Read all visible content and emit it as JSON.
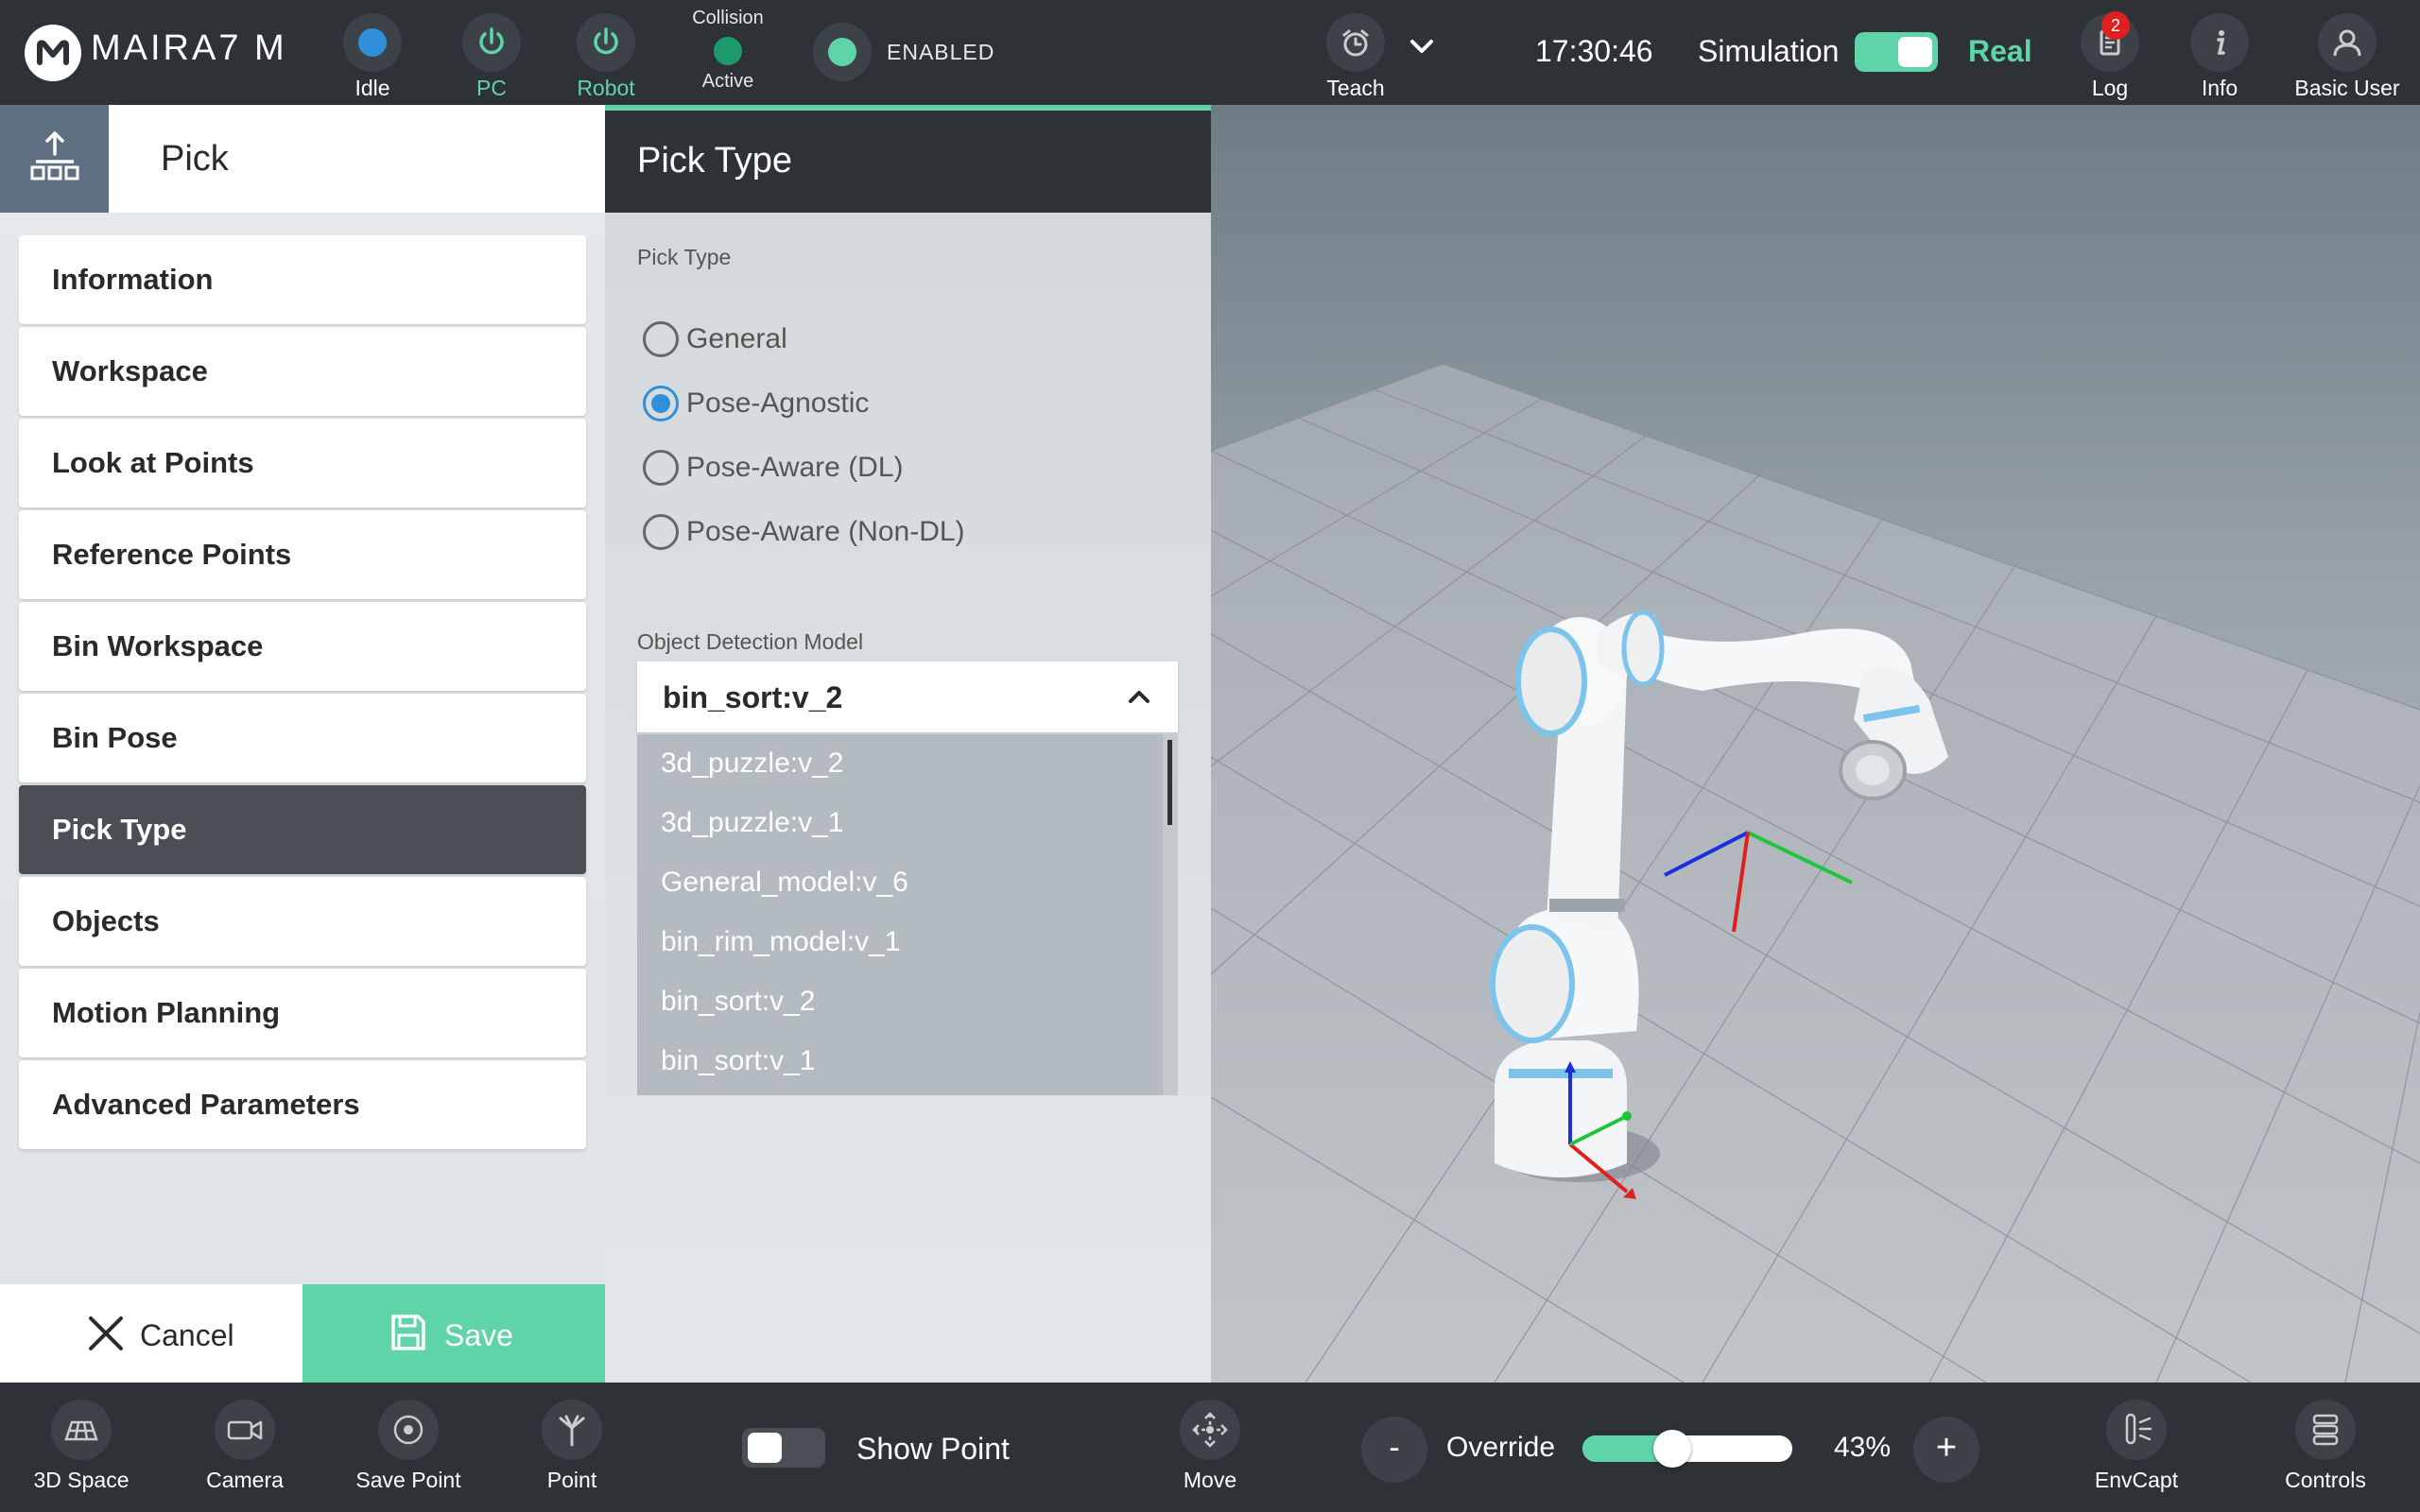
{
  "topbar": {
    "brand": "MAIRA7 M",
    "status_idle": "Idle",
    "status_pc": "PC",
    "status_robot": "Robot",
    "collision_title": "Collision",
    "collision_state": "Active",
    "enabled": "ENABLED",
    "teach": "Teach",
    "time": "17:30:46",
    "simulation": "Simulation",
    "real": "Real",
    "log": "Log",
    "log_badge": "2",
    "info": "Info",
    "user": "Basic User"
  },
  "left": {
    "title": "Pick",
    "menu": [
      "Information",
      "Workspace",
      "Look at Points",
      "Reference Points",
      "Bin Workspace",
      "Bin Pose",
      "Pick Type",
      "Objects",
      "Motion Planning",
      "Advanced Parameters"
    ],
    "active_index": 6,
    "cancel": "Cancel",
    "save": "Save"
  },
  "middle": {
    "title": "Pick Type",
    "pick_type_label": "Pick Type",
    "options": [
      "General",
      "Pose-Agnostic",
      "Pose-Aware (DL)",
      "Pose-Aware (Non-DL)"
    ],
    "selected_option": 1,
    "model_label": "Object Detection Model",
    "model_value": "bin_sort:v_2",
    "model_list": [
      "3d_puzzle:v_2",
      "3d_puzzle:v_1",
      "General_model:v_6",
      "bin_rim_model:v_1",
      "bin_sort:v_2",
      "bin_sort:v_1"
    ]
  },
  "bottombar": {
    "space3d": "3D Space",
    "camera": "Camera",
    "save_point": "Save Point",
    "point": "Point",
    "show_point": "Show Point",
    "move": "Move",
    "override_minus": "-",
    "override": "Override",
    "override_percent": 43,
    "override_value": "43%",
    "override_plus": "+",
    "envcapt": "EnvCapt",
    "controls": "Controls"
  },
  "colors": {
    "accent": "#5fd4a8",
    "status_blue": "#2f8fd8",
    "collision_green": "#1c9a6b",
    "badge_red": "#e02020"
  }
}
